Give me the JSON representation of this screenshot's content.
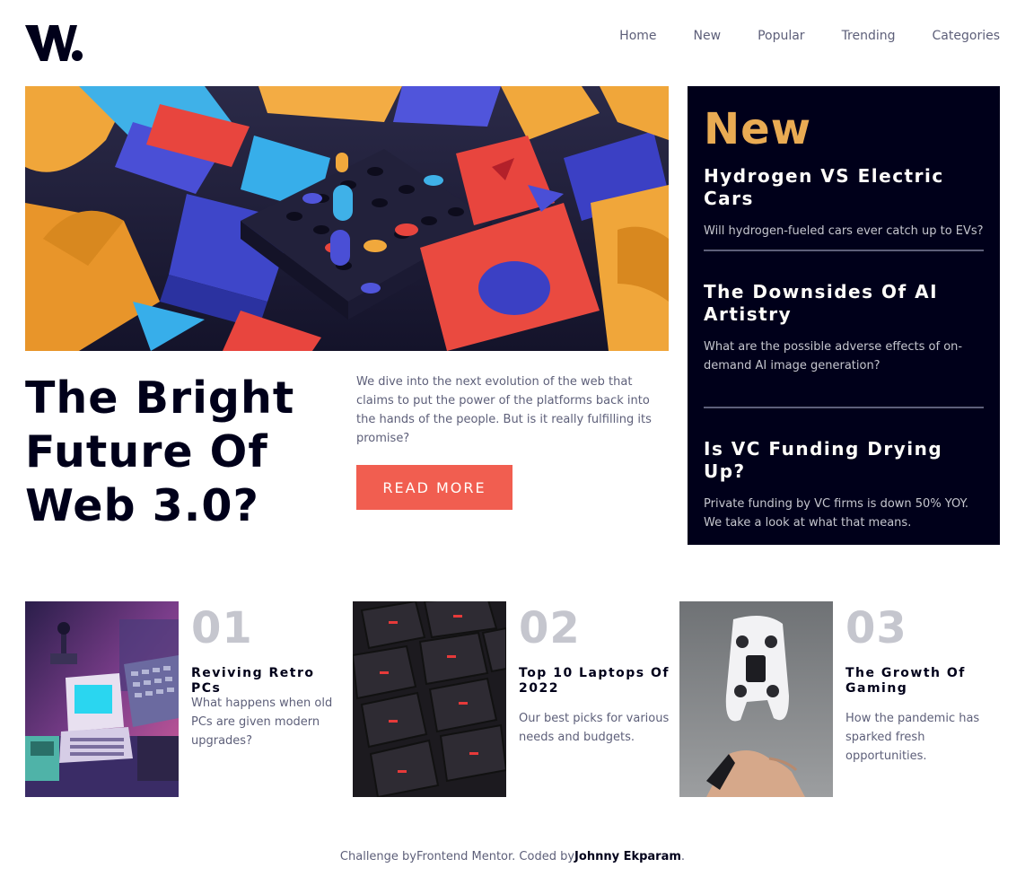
{
  "header": {
    "logo_alt": "W.",
    "nav": [
      {
        "label": "Home"
      },
      {
        "label": "New"
      },
      {
        "label": "Popular"
      },
      {
        "label": "Trending"
      },
      {
        "label": "Categories"
      }
    ]
  },
  "hero": {
    "image": "abstract-3d-blocks-image",
    "title": "The Bright Future Of Web 3.0?",
    "description": "We dive into the next evolution of the web that claims to put the power of the platforms back into the hands of the people. But is it really fulfilling its promise?",
    "button_label": "READ MORE"
  },
  "new_panel": {
    "heading": "New",
    "items": [
      {
        "title": "Hydrogen VS Electric Cars",
        "description": "Will hydrogen-fueled cars ever catch up to EVs?"
      },
      {
        "title": "The Downsides Of AI Artistry",
        "description": "What are the possible adverse effects of on-demand AI image generation?"
      },
      {
        "title": "Is VC Funding Drying Up?",
        "description": "Private funding by VC firms is down 50% YOY. We take a look at what that means."
      }
    ]
  },
  "cards": [
    {
      "number": "01",
      "title": "Reviving Retro PCs",
      "description": "What happens when old PCs are given modern upgrades?",
      "image": "retro-pc-image"
    },
    {
      "number": "02",
      "title": "Top 10 Laptops Of 2022",
      "description": "Our best picks for various needs and budgets.",
      "image": "keyboard-image"
    },
    {
      "number": "03",
      "title": "The Growth Of Gaming",
      "description": "How the pandemic has sparked fresh opportunities.",
      "image": "gamepad-image"
    }
  ],
  "footer": {
    "prefix": "Challenge by",
    "mentor": "Frontend Mentor",
    "middle": ". Coded by",
    "coder": "Johnny Ekparam",
    "suffix": "."
  },
  "colors": {
    "accent_orange": "#e9ab53",
    "accent_red": "#f15e50",
    "dark_navy": "#00001a",
    "grayish_blue": "#5d5f79",
    "grayish_light": "#c5c6ce",
    "off_white": "#fffdfa"
  }
}
